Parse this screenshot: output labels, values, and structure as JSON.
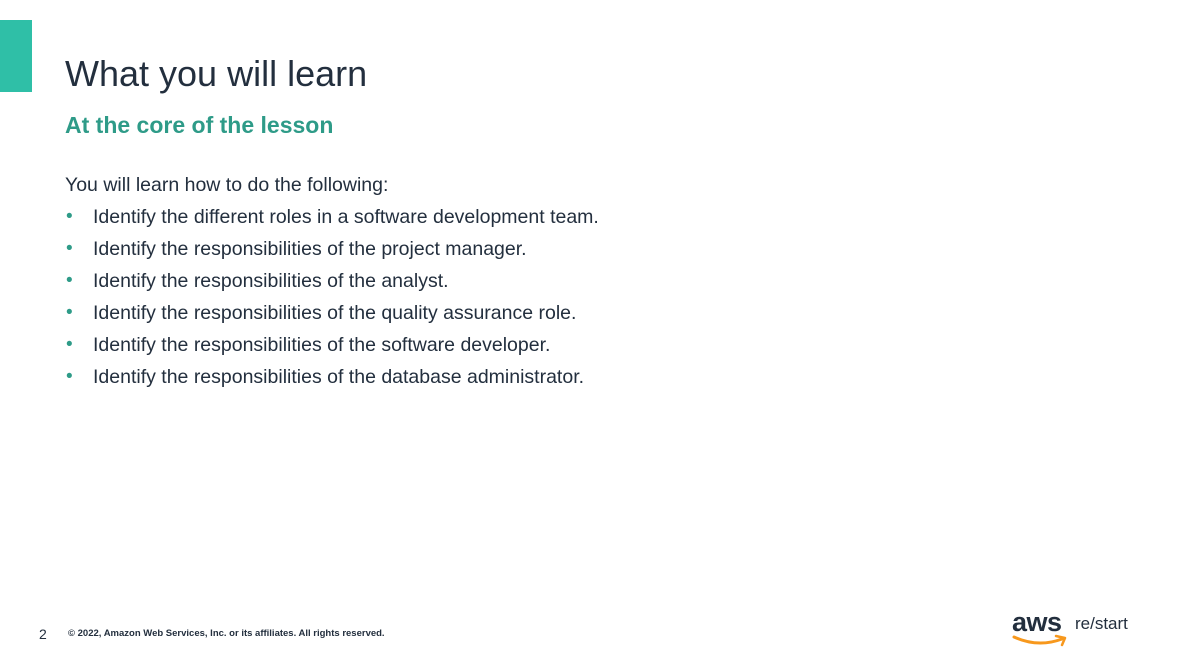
{
  "colors": {
    "accent": "#2fbfa7",
    "subtitle": "#2e9b88",
    "bullet": "#2e9b88",
    "text": "#232f3e",
    "logo_smile": "#f7981d"
  },
  "slide": {
    "title": "What you will learn",
    "subtitle": "At the core of the lesson",
    "intro": "You will learn how to do the following:",
    "bullets": [
      "Identify the different roles in a software development team.",
      "Identify the responsibilities of the project manager.",
      "Identify the responsibilities of the analyst.",
      "Identify the responsibilities of the quality assurance role.",
      "Identify the responsibilities of the software developer.",
      "Identify the responsibilities of the database administrator."
    ],
    "bullet_glyph": "•"
  },
  "footer": {
    "page_number": "2",
    "copyright": "© 2022, Amazon Web Services, Inc. or its affiliates. All rights reserved."
  },
  "logo": {
    "wordmark": "aws",
    "product": "re/start"
  }
}
